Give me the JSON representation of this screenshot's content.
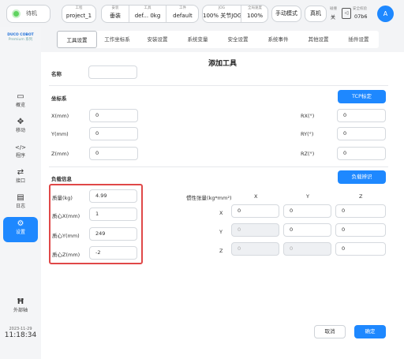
{
  "topbar": {
    "status_text": "待机",
    "project": {
      "label": "工程",
      "value": "project_1"
    },
    "install": {
      "label": "安装",
      "value": "垂装"
    },
    "tool": {
      "label": "工具",
      "value": "def...",
      "weight": "0kg"
    },
    "workpiece": {
      "label": "工件",
      "value": "default"
    },
    "jog": {
      "label": "JOG",
      "speed": "100%",
      "mode": "关节JOG"
    },
    "global_speed": {
      "label": "全局速度",
      "value": "100%"
    },
    "manual_mode": "手动模式",
    "real_machine": "真机",
    "collision": {
      "label": "碰撞",
      "value": "关"
    },
    "safety": {
      "label": "安全校验",
      "value": "07b6"
    },
    "avatar": "A"
  },
  "sidebar": {
    "brand": "DUCO COBOT",
    "brand_sub": "Premium 系列",
    "items": [
      {
        "label": "概览",
        "icon": "monitor-icon"
      },
      {
        "label": "移动",
        "icon": "move-arrows-icon"
      },
      {
        "label": "程序",
        "icon": "code-icon"
      },
      {
        "label": "接口",
        "icon": "swap-arrows-icon"
      },
      {
        "label": "日志",
        "icon": "calendar-icon"
      },
      {
        "label": "设置",
        "icon": "gear-icon"
      }
    ],
    "external_axis": {
      "label": "外部轴",
      "icon": "robot-arm-icon"
    },
    "date": "2023-11-29",
    "time": "11:18:34"
  },
  "tabs": [
    "工具设置",
    "工作坐标系",
    "安装设置",
    "系统变量",
    "安全设置",
    "系统事件",
    "其他设置",
    "插件设置"
  ],
  "active_tab": "工具设置",
  "form": {
    "title": "添加工具",
    "name_label": "名称",
    "name_value": "",
    "coord_section": "坐标系",
    "tcp_button": "TCP标定",
    "x_label": "X(mm)",
    "x_value": "0",
    "y_label": "Y(mm)",
    "y_value": "0",
    "z_label": "Z(mm)",
    "z_value": "0",
    "rx_label": "RX(°)",
    "rx_value": "0",
    "ry_label": "RY(°)",
    "ry_value": "0",
    "rz_label": "RZ(°)",
    "rz_value": "0",
    "payload_section": "负载信息",
    "payload_button": "负载辨识",
    "mass_label": "质量(kg)",
    "mass_value": "4.99",
    "cx_label": "质心X(mm)",
    "cx_value": "1",
    "cy_label": "质心Y(mm)",
    "cy_value": "249",
    "cz_label": "质心Z(mm)",
    "cz_value": "-2",
    "inertia_label": "惯性张量(kg*mm²)",
    "col_x": "X",
    "col_y": "Y",
    "col_z": "Z",
    "row_x": "X",
    "row_y": "Y",
    "row_z": "Z",
    "inertia": [
      [
        "0",
        "0",
        "0"
      ],
      [
        "0",
        "0",
        "0"
      ],
      [
        "0",
        "0",
        "0"
      ]
    ],
    "cancel": "取消",
    "confirm": "确定"
  },
  "colors": {
    "accent": "#1e88ff",
    "highlight_box": "#e04848",
    "status_green": "#5fd35f"
  }
}
